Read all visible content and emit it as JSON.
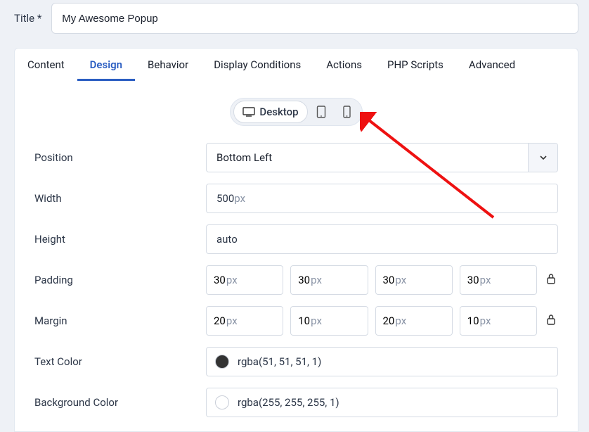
{
  "title": {
    "label": "Title *",
    "value": "My Awesome Popup"
  },
  "tabs": {
    "content": "Content",
    "design": "Design",
    "behavior": "Behavior",
    "display_conditions": "Display Conditions",
    "actions": "Actions",
    "php_scripts": "PHP Scripts",
    "advanced": "Advanced"
  },
  "device": {
    "desktop": "Desktop"
  },
  "fields": {
    "position": {
      "label": "Position",
      "value": "Bottom Left"
    },
    "width": {
      "label": "Width",
      "value": "500",
      "unit": "px"
    },
    "height": {
      "label": "Height",
      "value": "auto"
    },
    "padding": {
      "label": "Padding",
      "unit": "px",
      "top": "30",
      "right": "30",
      "bottom": "30",
      "left": "30"
    },
    "margin": {
      "label": "Margin",
      "unit": "px",
      "top": "20",
      "right": "10",
      "bottom": "20",
      "left": "10"
    },
    "text_color": {
      "label": "Text Color",
      "value": "rgba(51, 51, 51, 1)",
      "swatch": "#333333"
    },
    "background_color": {
      "label": "Background Color",
      "value": "rgba(255, 255, 255, 1)",
      "swatch": "#ffffff"
    }
  }
}
